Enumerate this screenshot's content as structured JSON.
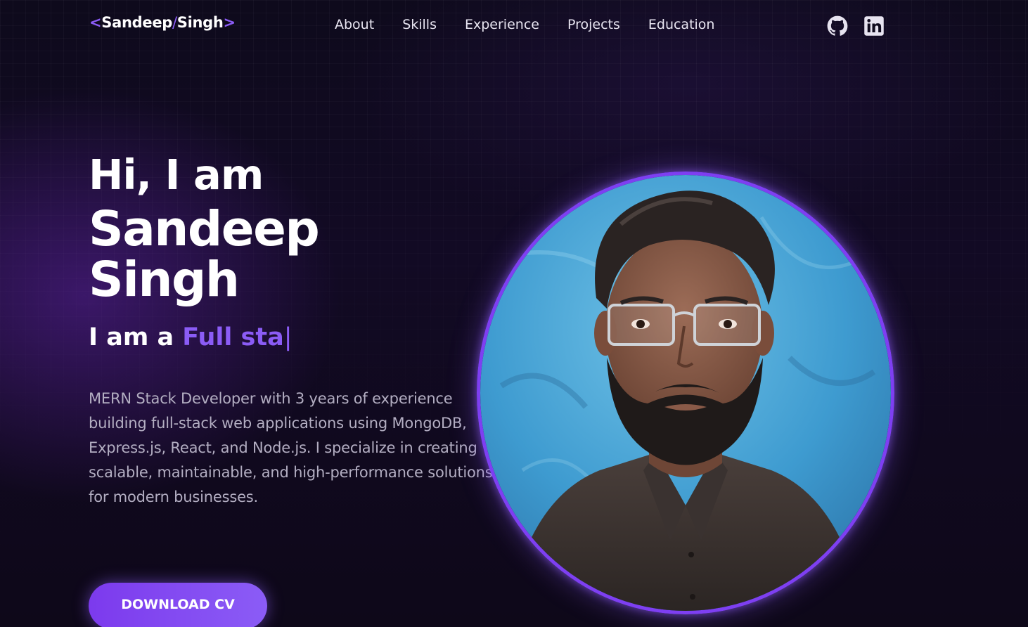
{
  "logo": {
    "open": "<",
    "first": "Sandeep",
    "slash": "/",
    "last": "Singh",
    "close": ">"
  },
  "nav": {
    "links": [
      "About",
      "Skills",
      "Experience",
      "Projects",
      "Education"
    ],
    "icons": [
      "github-icon",
      "linkedin-icon"
    ]
  },
  "hero": {
    "greeting": "Hi, I am",
    "name": "Sandeep Singh",
    "role_prefix": "I am a ",
    "role_typed": "Full sta",
    "cursor": "|",
    "description": "MERN Stack Developer with 3 years of experience building full-stack web applications using MongoDB, Express.js, React, and Node.js. I specialize in creating scalable, maintainable, and high-performance solutions for modern businesses.",
    "cv_button": "DOWNLOAD CV"
  },
  "colors": {
    "accent": "#8b5cf6",
    "background": "#0d0819",
    "ring": "#7e3ff2"
  }
}
